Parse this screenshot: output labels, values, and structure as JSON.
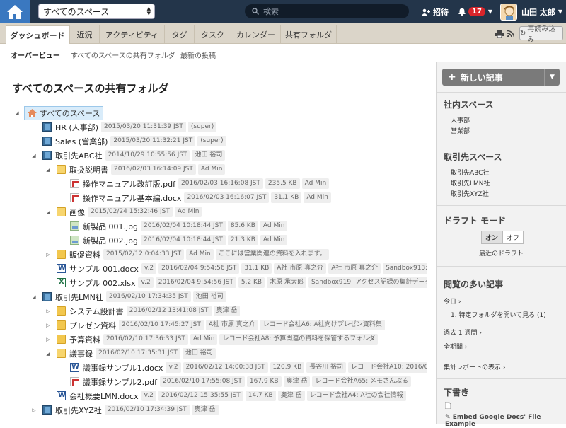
{
  "topbar": {
    "space_select": "すべてのスペース",
    "search_placeholder": "検索",
    "invite_label": "招待",
    "notification_count": "17",
    "user_name": "山田 太郎"
  },
  "tabs": [
    {
      "label": "ダッシュボード",
      "active": true
    },
    {
      "label": "近況"
    },
    {
      "label": "アクティビティ"
    },
    {
      "label": "タグ"
    },
    {
      "label": "タスク"
    },
    {
      "label": "カレンダー"
    },
    {
      "label": "共有フォルダ"
    }
  ],
  "reload_label": "再読み込み",
  "subnav": {
    "overview": "オーバービュー",
    "shared_folders": "すべてのスペースの共有フォルダ",
    "latest_posts": "最新の投稿"
  },
  "page_title": "すべてのスペースの共有フォルダ",
  "tree": {
    "root_label": "すべてのスペース",
    "rows": [
      {
        "name": "HR (人事部)",
        "icon": "book-icon",
        "meta": [
          "2015/03/20 11:31:39 JST",
          "(super)"
        ]
      },
      {
        "name": "Sales (営業部)",
        "icon": "book-icon",
        "meta": [
          "2015/03/20 11:32:21 JST",
          "(super)"
        ]
      },
      {
        "name": "取引先ABC社",
        "icon": "book-icon",
        "meta": [
          "2014/10/29 10:55:56 JST",
          "池田 裕司"
        ]
      },
      {
        "name": "取扱説明書",
        "icon": "folder-icon",
        "meta": [
          "2016/02/03 16:14:09 JST",
          "Ad Min"
        ]
      },
      {
        "name": "操作マニュアル改訂版.pdf",
        "icon": "pdf-icon",
        "meta": [
          "2016/02/03 16:16:08 JST",
          "235.5 KB",
          "Ad Min"
        ]
      },
      {
        "name": "操作マニュアル基本編.docx",
        "icon": "pdf-icon",
        "meta": [
          "2016/02/03 16:16:07 JST",
          "31.1 KB",
          "Ad Min"
        ]
      },
      {
        "name": "画像",
        "icon": "folder-icon",
        "meta": [
          "2015/02/24 15:32:46 JST",
          "Ad Min"
        ]
      },
      {
        "name": "新製品 001.jpg",
        "icon": "image-icon",
        "meta": [
          "2016/02/04 10:18:44 JST",
          "85.6 KB",
          "Ad Min"
        ]
      },
      {
        "name": "新製品 002.jpg",
        "icon": "image-icon",
        "meta": [
          "2016/02/04 10:18:44 JST",
          "21.3 KB",
          "Ad Min"
        ]
      },
      {
        "name": "販促資料",
        "icon": "folder-icon",
        "meta": [
          "2015/02/12 0:04:33 JST",
          "Ad Min",
          "ここには営業関連の資料を入れます。"
        ]
      },
      {
        "name": "サンプル 001.docx",
        "icon": "word-icon",
        "meta": [
          "v.2",
          "2016/02/04 9:54:56 JST",
          "31.1 KB",
          "A社 市原 真之介",
          "A社 市原 真之介",
          "Sandbox913: Wo"
        ]
      },
      {
        "name": "サンプル 002.xlsx",
        "icon": "excel-icon",
        "meta": [
          "v.2",
          "2016/02/04 9:54:56 JST",
          "5.2 KB",
          "木原 承太郎",
          "Sandbox919: アクセス記録の集計データ"
        ]
      },
      {
        "name": "取引先LMN社",
        "icon": "book-icon",
        "meta": [
          "2016/02/10 17:34:35 JST",
          "池田 裕司"
        ]
      },
      {
        "name": "システム設計書",
        "icon": "folder-icon",
        "meta": [
          "2016/02/12 13:41:08 JST",
          "奥津 岳"
        ]
      },
      {
        "name": "プレゼン資料",
        "icon": "folder-icon",
        "meta": [
          "2016/02/10 17:45:27 JST",
          "A社 市原 真之介",
          "レコード会社A6: A社向けプレゼン資料集"
        ]
      },
      {
        "name": "予算資料",
        "icon": "folder-icon",
        "meta": [
          "2016/02/10 17:36:33 JST",
          "Ad Min",
          "レコード会社A8: 予算関連の資料を保管するフォルダ"
        ]
      },
      {
        "name": "議事録",
        "icon": "folder-icon",
        "meta": [
          "2016/02/10 17:35:31 JST",
          "池田 裕司"
        ]
      },
      {
        "name": "議事録サンプル1.docx",
        "icon": "word-icon",
        "meta": [
          "v.2",
          "2016/02/12 14:00:38 JST",
          "120.9 KB",
          "長谷川 裕司",
          "レコード会社A10: 2016/01/04"
        ]
      },
      {
        "name": "議事録サンプル2.pdf",
        "icon": "pdf-icon",
        "meta": [
          "2016/02/10 17:55:08 JST",
          "167.9 KB",
          "奥津 岳",
          "レコード会社A65: メモさんぷる"
        ]
      },
      {
        "name": "会社概要LMN.docx",
        "icon": "word-icon",
        "meta": [
          "v.2",
          "2016/02/12 15:35:55 JST",
          "14.7 KB",
          "奥津 岳",
          "レコード会社A4: A社の会社情報"
        ]
      },
      {
        "name": "取引先XYZ社",
        "icon": "book-icon",
        "meta": [
          "2016/02/10 17:34:39 JST",
          "奥津 岳"
        ]
      }
    ]
  },
  "sidebar": {
    "new_post": "新しい記事",
    "internal_spaces_title": "社内スペース",
    "internal_spaces": [
      "人事部",
      "営業部"
    ],
    "client_spaces_title": "取引先スペース",
    "client_spaces": [
      "取引先ABC社",
      "取引先LMN社",
      "取引先XYZ社"
    ],
    "draft_mode_title": "ドラフト モード",
    "draft_on": "オン",
    "draft_off": "オフ",
    "recent_drafts": "最近のドラフト",
    "popular_title": "閲覧の多い記事",
    "today": "今日",
    "popular_item": "1. 特定フォルダを開いて見る (1)",
    "past_week": "過去 1 週間",
    "all_time": "全期間",
    "report_view": "集計レポートの表示",
    "drafts_title": "下書き",
    "draft_item": "Embed Google Docs' File Example"
  },
  "colors": {
    "topbar": "#23354a",
    "accent": "#3a78c0",
    "badge": "#d9252b"
  }
}
